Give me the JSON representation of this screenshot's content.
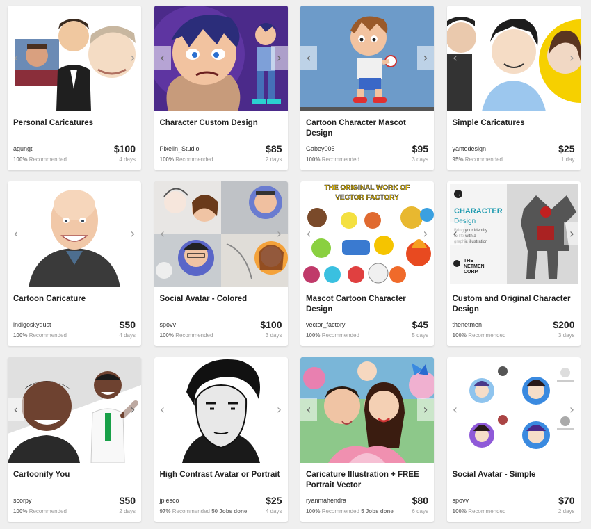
{
  "cards": [
    {
      "title": "Personal Caricatures",
      "seller": "agungt",
      "price": "$100",
      "recommended_pct": "100%",
      "recommended_label": "Recommended",
      "jobs_done": "",
      "days": "4 days",
      "art": "caricature-trio",
      "arrows": "plain"
    },
    {
      "title": "Character Custom Design",
      "seller": "Pixelin_Studio",
      "price": "$85",
      "recommended_pct": "100%",
      "recommended_label": "Recommended",
      "jobs_done": "",
      "days": "2 days",
      "art": "purple-character",
      "arrows": "boxed"
    },
    {
      "title": "Cartoon Character Mascot Design",
      "seller": "Gabey005",
      "price": "$95",
      "recommended_pct": "100%",
      "recommended_label": "Recommended",
      "jobs_done": "",
      "days": "3 days",
      "art": "mascot-boy",
      "arrows": "boxed"
    },
    {
      "title": "Simple Caricatures",
      "seller": "yantodesign",
      "price": "$25",
      "recommended_pct": "95%",
      "recommended_label": "Recommended",
      "jobs_done": "",
      "days": "1 day",
      "art": "simple-faces",
      "arrows": "plain"
    },
    {
      "title": "Cartoon Caricature",
      "seller": "indigoskydust",
      "price": "$50",
      "recommended_pct": "100%",
      "recommended_label": "Recommended",
      "jobs_done": "",
      "days": "4 days",
      "art": "bald-man",
      "arrows": "plain"
    },
    {
      "title": "Social Avatar - Colored",
      "seller": "spovv",
      "price": "$100",
      "recommended_pct": "100%",
      "recommended_label": "Recommended",
      "jobs_done": "",
      "days": "3 days",
      "art": "avatar-collage",
      "arrows": "plain"
    },
    {
      "title": "Mascot Cartoon Character Design",
      "seller": "vector_factory",
      "price": "$45",
      "recommended_pct": "100%",
      "recommended_label": "Recommended",
      "jobs_done": "",
      "days": "5 days",
      "art": "mascot-collection",
      "arrows": "plain",
      "banner": "THE ORIGINAL WORK OF VECTOR FACTORY"
    },
    {
      "title": "Custom and Original Character Design",
      "seller": "thenetmen",
      "price": "$200",
      "recommended_pct": "100%",
      "recommended_label": "Recommended",
      "jobs_done": "",
      "days": "3 days",
      "art": "robot-promo",
      "arrows": "boxed",
      "promo_heading": "CHARACTER",
      "promo_sub": "Design",
      "promo_text": "Bring your identity to life with a graphic illustration",
      "promo_brand": "THE NETMEN CORP."
    },
    {
      "title": "Cartoonify You",
      "seller": "scorpy",
      "price": "$50",
      "recommended_pct": "100%",
      "recommended_label": "Recommended",
      "jobs_done": "",
      "days": "2 days",
      "art": "doctor-cartoon",
      "arrows": "boxed"
    },
    {
      "title": "High Contrast Avatar or Portrait",
      "seller": "jpiesco",
      "price": "$25",
      "recommended_pct": "97%",
      "recommended_label": "Recommended",
      "jobs_done": "50 Jobs done",
      "days": "4 days",
      "art": "bw-portrait",
      "arrows": "plain"
    },
    {
      "title": "Caricature Illustration + FREE Portrait Vector",
      "seller": "ryanmahendra",
      "price": "$80",
      "recommended_pct": "100%",
      "recommended_label": "Recommended",
      "jobs_done": "5 Jobs done",
      "days": "6 days",
      "art": "family-caricature",
      "arrows": "boxed"
    },
    {
      "title": "Social Avatar - Simple",
      "seller": "spovv",
      "price": "$70",
      "recommended_pct": "100%",
      "recommended_label": "Recommended",
      "jobs_done": "",
      "days": "2 days",
      "art": "simple-avatars",
      "arrows": "plain"
    }
  ],
  "icons": {
    "prev": "chevron-left-icon",
    "next": "chevron-right-icon"
  },
  "colors": {
    "card_bg": "#ffffff",
    "page_bg": "#efefef",
    "muted": "#999999",
    "title": "#222222"
  }
}
